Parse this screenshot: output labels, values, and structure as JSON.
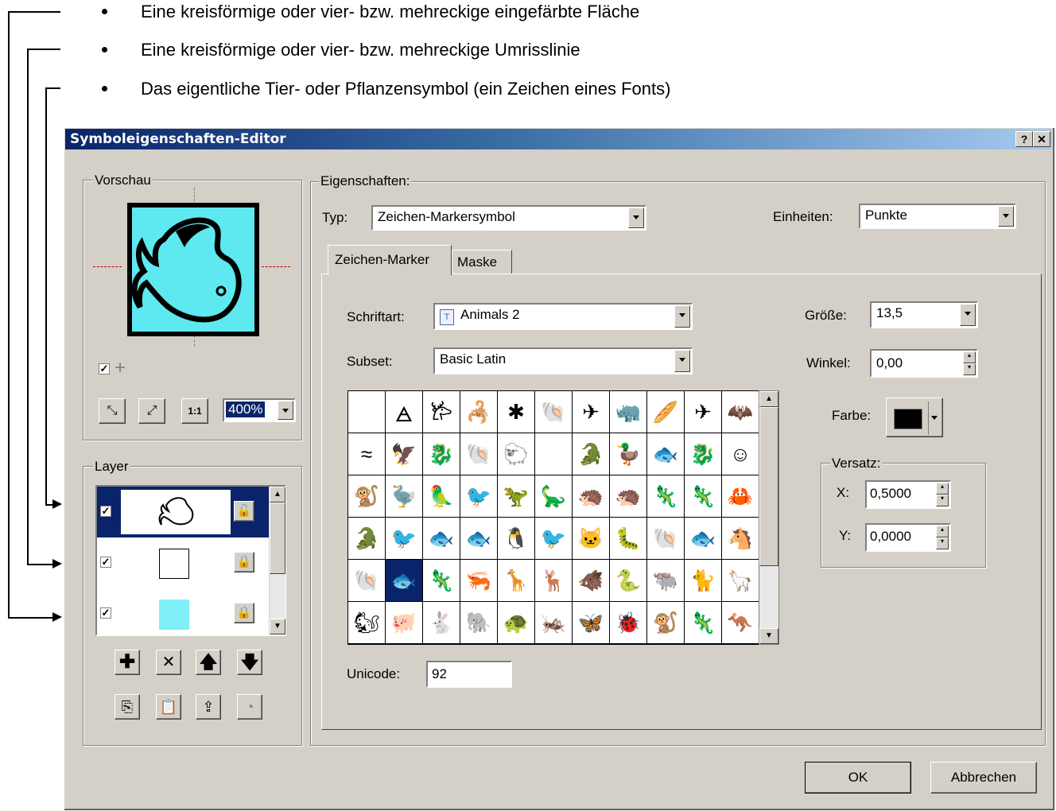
{
  "bullets": [
    "Eine kreisförmige oder vier- bzw. mehreckige eingefärbte Fläche",
    "Eine kreisförmige oder vier- bzw. mehreckige Umrisslinie",
    "Das eigentliche Tier- oder Pflanzensymbol (ein Zeichen eines Fonts)"
  ],
  "window": {
    "title": "Symboleigenschaften-Editor",
    "help_button": "?",
    "close_button": "✕"
  },
  "preview": {
    "group_label": "Vorschau",
    "zoom": "400%",
    "checked": true,
    "fill_color": "#5ee8ef",
    "zoom_buttons": [
      "fit-icon",
      "expand-icon",
      "actual-size-icon"
    ],
    "actual_size_label": "1:1"
  },
  "layers": {
    "group_label": "Layer",
    "items": [
      {
        "checked": true,
        "content": "fish-symbol",
        "selected": true
      },
      {
        "checked": true,
        "content": "outline-square",
        "selected": false
      },
      {
        "checked": true,
        "content": "fill-square",
        "color": "#7ff0f7",
        "selected": false
      }
    ],
    "buttons": [
      "add-icon",
      "delete-icon",
      "up-arrow-icon",
      "down-arrow-icon"
    ],
    "buttons2": [
      "copy-icon",
      "paste-icon",
      "import-icon",
      "effects-icon"
    ]
  },
  "properties": {
    "group_label": "Eigenschaften:",
    "type_label": "Typ:",
    "type_value": "Zeichen-Markersymbol",
    "units_label": "Einheiten:",
    "units_value": "Punkte",
    "tabs": [
      "Zeichen-Marker",
      "Maske"
    ],
    "font_label": "Schriftart:",
    "font_value": "Animals 2",
    "subset_label": "Subset:",
    "subset_value": "Basic Latin",
    "size_label": "Größe:",
    "size_value": "13,5",
    "angle_label": "Winkel:",
    "angle_value": "0,00",
    "color_label": "Farbe:",
    "color_value": "#000000",
    "offset_label": "Versatz:",
    "x_label": "X:",
    "x_value": "0,5000",
    "y_label": "Y:",
    "y_value": "0,0000",
    "unicode_label": "Unicode:",
    "unicode_value": "92"
  },
  "glyphs": [
    "",
    "🜁",
    "𐂂",
    "🦂",
    "✱",
    "🐚",
    "✈",
    "🦏",
    "🥖",
    "✈",
    "🦇",
    "≈",
    "🦅",
    "🐉",
    "🐚",
    "🐑",
    "",
    "🐊",
    "🦆",
    "🐟",
    "🐉",
    "☺",
    "🐒",
    "🦤",
    "🦜",
    "🐦",
    "🦖",
    "🦕",
    "🦔",
    "🦔",
    "🦎",
    "🦎",
    "🦀",
    "🐊",
    "🐦",
    "🐟",
    "🐟",
    "🐧",
    "🐦",
    "🐱",
    "🐛",
    "🐚",
    "🐟",
    "🐴",
    "🐚",
    "🐟",
    "🦎",
    "🦐",
    "🦒",
    "🦌",
    "🐗",
    "🐍",
    "🐃",
    "🐈",
    "🦙",
    "🐿",
    "🐖",
    "🐇",
    "🐘",
    "🐢",
    "🦗",
    "🦋",
    "🐞",
    "🐒",
    "🦎",
    "🦘"
  ],
  "footer": {
    "ok_label": "OK",
    "cancel_label": "Abbrechen"
  }
}
